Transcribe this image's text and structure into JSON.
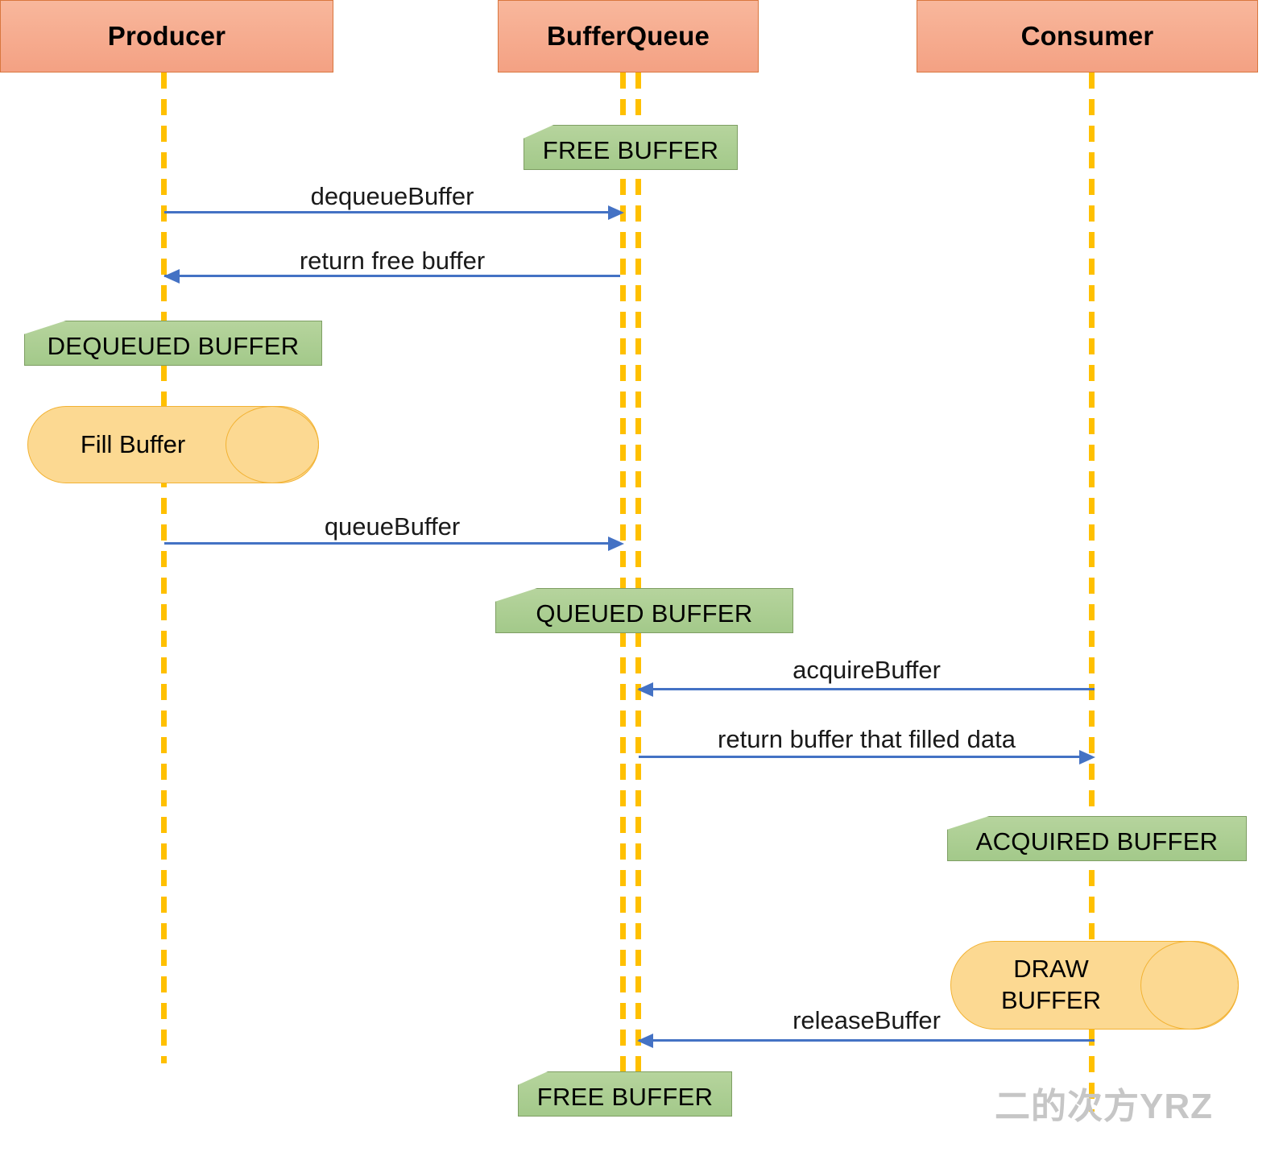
{
  "diagram": {
    "title": "BufferQueue producer-consumer sequence diagram",
    "colors": {
      "actor_fill": "#F4A183",
      "actor_border": "#D9773F",
      "lifeline": "#FFC000",
      "note_fill": "#A3C98A",
      "note_border": "#7E9E63",
      "process_fill": "#FCD992",
      "process_border": "#F2B233",
      "arrow": "#4472C4",
      "watermark": "#C6C6C6"
    }
  },
  "actors": [
    {
      "name": "producer",
      "label": "Producer"
    },
    {
      "name": "bufferqueue",
      "label": "BufferQueue"
    },
    {
      "name": "consumer",
      "label": "Consumer"
    }
  ],
  "notes": [
    {
      "name": "note-free-buffer-top",
      "label": "FREE BUFFER"
    },
    {
      "name": "note-dequeued-buffer",
      "label": "DEQUEUED BUFFER"
    },
    {
      "name": "note-queued-buffer",
      "label": "QUEUED BUFFER"
    },
    {
      "name": "note-acquired-buffer",
      "label": "ACQUIRED BUFFER"
    },
    {
      "name": "note-free-buffer-bottom",
      "label": "FREE BUFFER"
    }
  ],
  "processes": [
    {
      "name": "process-fill-buffer",
      "label": "Fill Buffer"
    },
    {
      "name": "process-draw-buffer",
      "label": "DRAW\nBUFFER"
    }
  ],
  "messages": [
    {
      "name": "message-dequeue-buffer",
      "label": "dequeueBuffer",
      "from": "Producer",
      "to": "BufferQueue",
      "direction": "right"
    },
    {
      "name": "message-return-free-buffer",
      "label": "return free buffer",
      "from": "BufferQueue",
      "to": "Producer",
      "direction": "left"
    },
    {
      "name": "message-queue-buffer",
      "label": "queueBuffer",
      "from": "Producer",
      "to": "BufferQueue",
      "direction": "right"
    },
    {
      "name": "message-acquire-buffer",
      "label": "acquireBuffer",
      "from": "Consumer",
      "to": "BufferQueue",
      "direction": "left"
    },
    {
      "name": "message-return-buffer-filled",
      "label": "return buffer that filled data",
      "from": "BufferQueue",
      "to": "Consumer",
      "direction": "right"
    },
    {
      "name": "message-release-buffer",
      "label": "releaseBuffer",
      "from": "Consumer",
      "to": "BufferQueue",
      "direction": "left"
    }
  ],
  "watermark": {
    "label": "二的次方YRZ"
  }
}
